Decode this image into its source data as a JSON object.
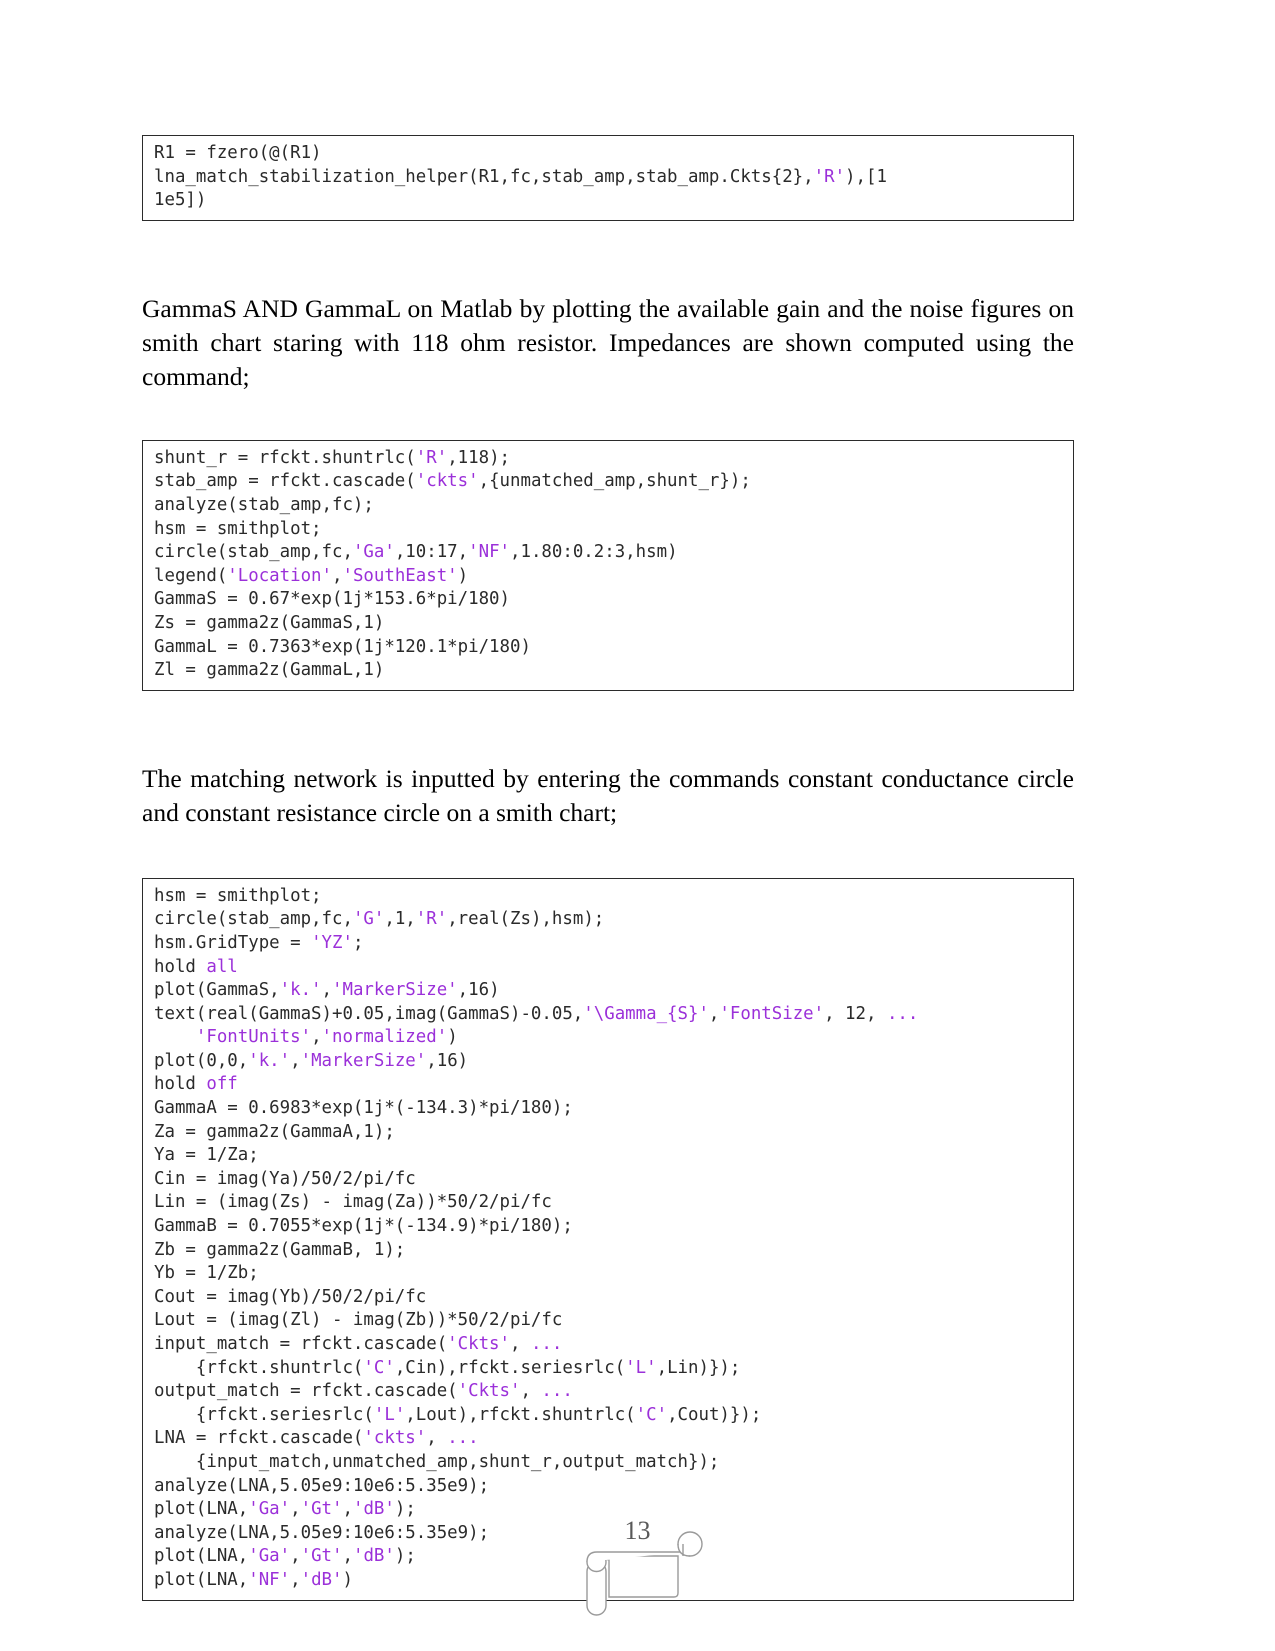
{
  "document": {
    "page_number": "13",
    "accent_string_color": "#9b30d9",
    "code_text_color": "#2a2a2a",
    "body_text_color": "#000000",
    "border_color": "#2b2b2b"
  },
  "code_block_1": {
    "name": "fzero-stabilization-solve",
    "lines": [
      [
        {
          "t": "R1 = fzero(@(R1)",
          "c": "plain"
        }
      ],
      [
        {
          "t": "lna_match_stabilization_helper(R1,fc,stab_amp,stab_amp.Ckts{2},",
          "c": "plain"
        },
        {
          "t": "'R'",
          "c": "str"
        },
        {
          "t": "),[1",
          "c": "plain"
        }
      ],
      [
        {
          "t": "1e5])",
          "c": "plain"
        }
      ]
    ]
  },
  "paragraph_1": {
    "text": "GammaS AND GammaL on Matlab by plotting the available gain and the noise figures on smith chart staring with 118 ohm resistor. Impedances are shown computed using the command;"
  },
  "code_block_2": {
    "name": "gammas-gammal-smithchart",
    "lines": [
      [
        {
          "t": "shunt_r = rfckt.shuntrlc(",
          "c": "plain"
        },
        {
          "t": "'R'",
          "c": "str"
        },
        {
          "t": ",118);",
          "c": "plain"
        }
      ],
      [
        {
          "t": "stab_amp = rfckt.cascade(",
          "c": "plain"
        },
        {
          "t": "'ckts'",
          "c": "str"
        },
        {
          "t": ",{unmatched_amp,shunt_r});",
          "c": "plain"
        }
      ],
      [
        {
          "t": "analyze(stab_amp,fc);",
          "c": "plain"
        }
      ],
      [
        {
          "t": "hsm = smithplot;",
          "c": "plain"
        }
      ],
      [
        {
          "t": "circle(stab_amp,fc,",
          "c": "plain"
        },
        {
          "t": "'Ga'",
          "c": "str"
        },
        {
          "t": ",10:17,",
          "c": "plain"
        },
        {
          "t": "'NF'",
          "c": "str"
        },
        {
          "t": ",1.80:0.2:3,hsm)",
          "c": "plain"
        }
      ],
      [
        {
          "t": "legend(",
          "c": "plain"
        },
        {
          "t": "'Location'",
          "c": "str"
        },
        {
          "t": ",",
          "c": "plain"
        },
        {
          "t": "'SouthEast'",
          "c": "str"
        },
        {
          "t": ")",
          "c": "plain"
        }
      ],
      [
        {
          "t": "GammaS = 0.67*exp(1j*153.6*pi/180)",
          "c": "plain"
        }
      ],
      [
        {
          "t": "Zs = gamma2z(GammaS,1)",
          "c": "plain"
        }
      ],
      [
        {
          "t": "GammaL = 0.7363*exp(1j*120.1*pi/180)",
          "c": "plain"
        }
      ],
      [
        {
          "t": "Zl = gamma2z(GammaL,1)",
          "c": "plain"
        }
      ]
    ]
  },
  "paragraph_2": {
    "text": "The matching network is inputted by entering the commands constant conductance circle and constant resistance circle on a smith chart;"
  },
  "code_block_3": {
    "name": "matching-network-design",
    "lines": [
      [
        {
          "t": "hsm = smithplot;",
          "c": "plain"
        }
      ],
      [
        {
          "t": "circle(stab_amp,fc,",
          "c": "plain"
        },
        {
          "t": "'G'",
          "c": "str"
        },
        {
          "t": ",1,",
          "c": "plain"
        },
        {
          "t": "'R'",
          "c": "str"
        },
        {
          "t": ",real(Zs),hsm);",
          "c": "plain"
        }
      ],
      [
        {
          "t": "hsm.GridType = ",
          "c": "plain"
        },
        {
          "t": "'YZ'",
          "c": "str"
        },
        {
          "t": ";",
          "c": "plain"
        }
      ],
      [
        {
          "t": "hold ",
          "c": "plain"
        },
        {
          "t": "all",
          "c": "kw"
        }
      ],
      [
        {
          "t": "plot(GammaS,",
          "c": "plain"
        },
        {
          "t": "'k.'",
          "c": "str"
        },
        {
          "t": ",",
          "c": "plain"
        },
        {
          "t": "'MarkerSize'",
          "c": "str"
        },
        {
          "t": ",16)",
          "c": "plain"
        }
      ],
      [
        {
          "t": "text(real(GammaS)+0.05,imag(GammaS)-0.05,",
          "c": "plain"
        },
        {
          "t": "'\\Gamma_{S}'",
          "c": "str"
        },
        {
          "t": ",",
          "c": "plain"
        },
        {
          "t": "'FontSize'",
          "c": "str"
        },
        {
          "t": ", 12, ",
          "c": "plain"
        },
        {
          "t": "...",
          "c": "cont"
        }
      ],
      [
        {
          "t": "    ",
          "c": "plain"
        },
        {
          "t": "'FontUnits'",
          "c": "str"
        },
        {
          "t": ",",
          "c": "plain"
        },
        {
          "t": "'normalized'",
          "c": "str"
        },
        {
          "t": ")",
          "c": "plain"
        }
      ],
      [
        {
          "t": "plot(0,0,",
          "c": "plain"
        },
        {
          "t": "'k.'",
          "c": "str"
        },
        {
          "t": ",",
          "c": "plain"
        },
        {
          "t": "'MarkerSize'",
          "c": "str"
        },
        {
          "t": ",16)",
          "c": "plain"
        }
      ],
      [
        {
          "t": "hold ",
          "c": "plain"
        },
        {
          "t": "off",
          "c": "kw"
        }
      ],
      [
        {
          "t": "GammaA = 0.6983*exp(1j*(-134.3)*pi/180);",
          "c": "plain"
        }
      ],
      [
        {
          "t": "Za = gamma2z(GammaA,1);",
          "c": "plain"
        }
      ],
      [
        {
          "t": "Ya = 1/Za;",
          "c": "plain"
        }
      ],
      [
        {
          "t": "Cin = imag(Ya)/50/2/pi/fc",
          "c": "plain"
        }
      ],
      [
        {
          "t": "Lin = (imag(Zs) - imag(Za))*50/2/pi/fc",
          "c": "plain"
        }
      ],
      [
        {
          "t": "GammaB = 0.7055*exp(1j*(-134.9)*pi/180);",
          "c": "plain"
        }
      ],
      [
        {
          "t": "Zb = gamma2z(GammaB, 1);",
          "c": "plain"
        }
      ],
      [
        {
          "t": "Yb = 1/Zb;",
          "c": "plain"
        }
      ],
      [
        {
          "t": "Cout = imag(Yb)/50/2/pi/fc",
          "c": "plain"
        }
      ],
      [
        {
          "t": "Lout = (imag(Zl) - imag(Zb))*50/2/pi/fc",
          "c": "plain"
        }
      ],
      [
        {
          "t": "input_match = rfckt.cascade(",
          "c": "plain"
        },
        {
          "t": "'Ckts'",
          "c": "str"
        },
        {
          "t": ", ",
          "c": "plain"
        },
        {
          "t": "...",
          "c": "cont"
        }
      ],
      [
        {
          "t": "    {rfckt.shuntrlc(",
          "c": "plain"
        },
        {
          "t": "'C'",
          "c": "str"
        },
        {
          "t": ",Cin),rfckt.seriesrlc(",
          "c": "plain"
        },
        {
          "t": "'L'",
          "c": "str"
        },
        {
          "t": ",Lin)});",
          "c": "plain"
        }
      ],
      [
        {
          "t": "output_match = rfckt.cascade(",
          "c": "plain"
        },
        {
          "t": "'Ckts'",
          "c": "str"
        },
        {
          "t": ", ",
          "c": "plain"
        },
        {
          "t": "...",
          "c": "cont"
        }
      ],
      [
        {
          "t": "    {rfckt.seriesrlc(",
          "c": "plain"
        },
        {
          "t": "'L'",
          "c": "str"
        },
        {
          "t": ",Lout),rfckt.shuntrlc(",
          "c": "plain"
        },
        {
          "t": "'C'",
          "c": "str"
        },
        {
          "t": ",Cout)});",
          "c": "plain"
        }
      ],
      [
        {
          "t": "LNA = rfckt.cascade(",
          "c": "plain"
        },
        {
          "t": "'ckts'",
          "c": "str"
        },
        {
          "t": ", ",
          "c": "plain"
        },
        {
          "t": "...",
          "c": "cont"
        }
      ],
      [
        {
          "t": "    {input_match,unmatched_amp,shunt_r,output_match});",
          "c": "plain"
        }
      ],
      [
        {
          "t": "analyze(LNA,5.05e9:10e6:5.35e9);",
          "c": "plain"
        }
      ],
      [
        {
          "t": "plot(LNA,",
          "c": "plain"
        },
        {
          "t": "'Ga'",
          "c": "str"
        },
        {
          "t": ",",
          "c": "plain"
        },
        {
          "t": "'Gt'",
          "c": "str"
        },
        {
          "t": ",",
          "c": "plain"
        },
        {
          "t": "'dB'",
          "c": "str"
        },
        {
          "t": ");",
          "c": "plain"
        }
      ],
      [
        {
          "t": "analyze(LNA,5.05e9:10e6:5.35e9);",
          "c": "plain"
        }
      ],
      [
        {
          "t": "plot(LNA,",
          "c": "plain"
        },
        {
          "t": "'Ga'",
          "c": "str"
        },
        {
          "t": ",",
          "c": "plain"
        },
        {
          "t": "'Gt'",
          "c": "str"
        },
        {
          "t": ",",
          "c": "plain"
        },
        {
          "t": "'dB'",
          "c": "str"
        },
        {
          "t": ");",
          "c": "plain"
        }
      ],
      [
        {
          "t": "plot(LNA,",
          "c": "plain"
        },
        {
          "t": "'NF'",
          "c": "str"
        },
        {
          "t": ",",
          "c": "plain"
        },
        {
          "t": "'dB'",
          "c": "str"
        },
        {
          "t": ")",
          "c": "plain"
        }
      ]
    ]
  }
}
